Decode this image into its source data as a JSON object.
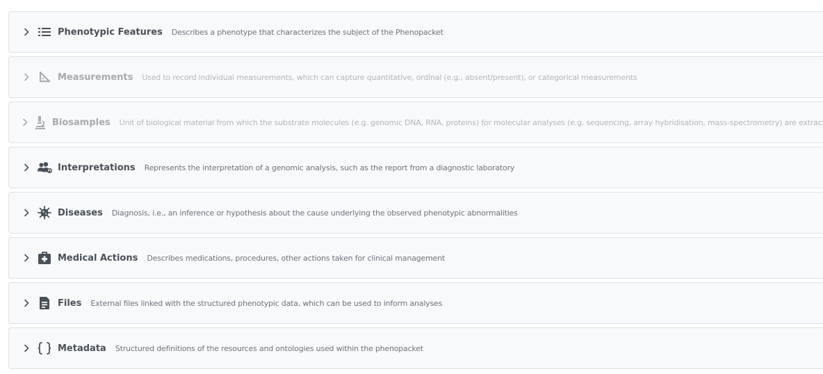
{
  "colors": {
    "panel_background": "#f8f9fa",
    "panel_border": "#dee2e6",
    "title_text": "#495057",
    "description_text": "#6c757d",
    "disabled_text": "#a6abb0"
  },
  "sections": [
    {
      "title": "Phenotypic Features",
      "description": "Describes a phenotype that characterizes the subject of the Phenopacket",
      "icon": "list-icon",
      "disabled": false
    },
    {
      "title": "Measurements",
      "description": "Used to record individual measurements, which can capture quantitative, ordinal (e.g., absent/present), or categorical measurements",
      "icon": "ruler-triangle-icon",
      "disabled": true
    },
    {
      "title": "Biosamples",
      "description": "Unit of biological material from which the substrate molecules (e.g. genomic DNA, RNA, proteins) for molecular analyses (e.g. sequencing, array hybridisation, mass-spectrometry) are extracted",
      "icon": "microscope-icon",
      "disabled": true
    },
    {
      "title": "Interpretations",
      "description": "Represents the interpretation of a genomic analysis, such as the report from a diagnostic laboratory",
      "icon": "user-group-icon",
      "disabled": false
    },
    {
      "title": "Diseases",
      "description": "Diagnosis, i.e., an inference or hypothesis about the cause underlying the observed phenotypic abnormalities",
      "icon": "virus-icon",
      "disabled": false
    },
    {
      "title": "Medical Actions",
      "description": "Describes medications, procedures, other actions taken for clinical management",
      "icon": "medical-kit-icon",
      "disabled": false
    },
    {
      "title": "Files",
      "description": "External files linked with the structured phenotypic data, which can be used to inform analyses",
      "icon": "file-icon",
      "disabled": false
    },
    {
      "title": "Metadata",
      "description": "Structured definitions of the resources and ontologies used within the phenopacket",
      "icon": "braces-icon",
      "disabled": false
    }
  ]
}
